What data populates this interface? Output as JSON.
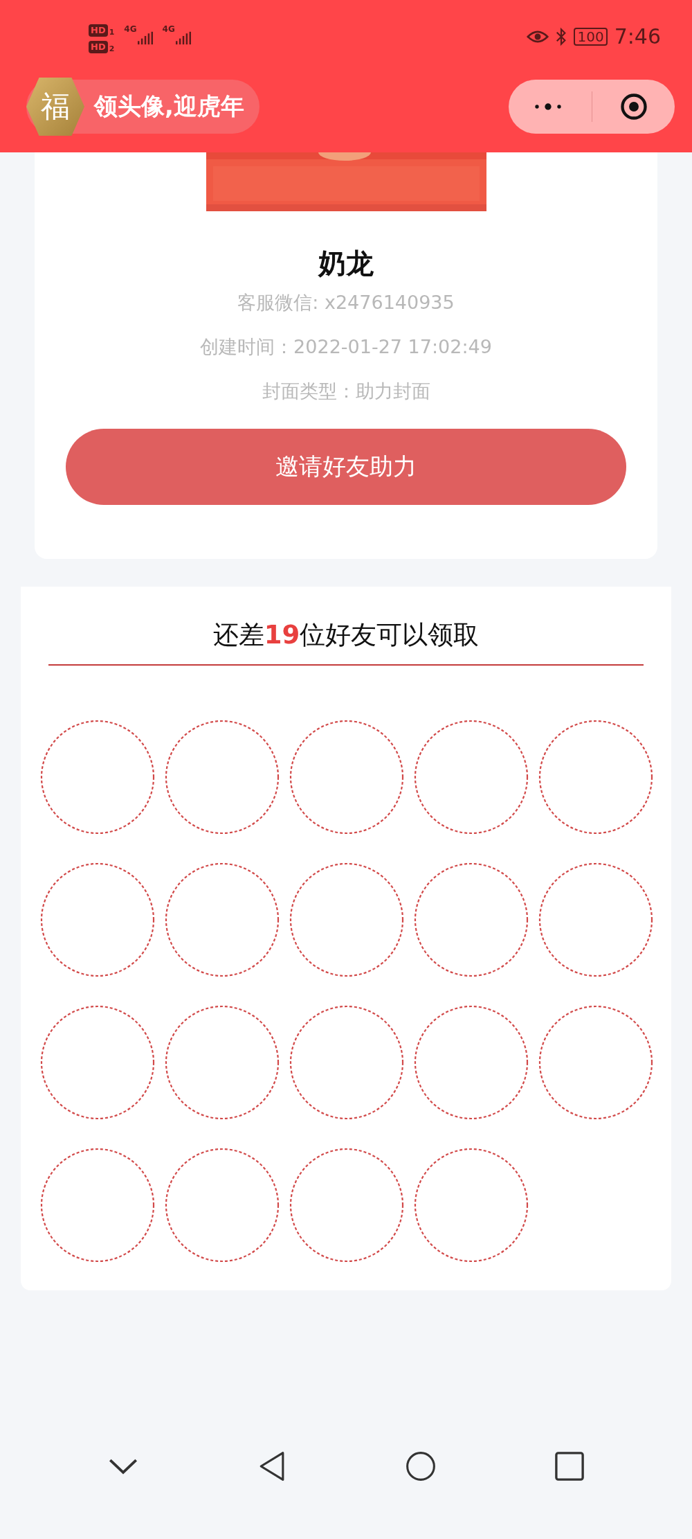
{
  "status_bar": {
    "sims": [
      {
        "label": "HD",
        "slot": "1"
      },
      {
        "label": "HD",
        "slot": "2"
      }
    ],
    "networks": [
      "4G",
      "4G"
    ],
    "battery": "100",
    "time": "7:46"
  },
  "nav": {
    "badge": "福",
    "title": "领头像,迎虎年"
  },
  "cover": {
    "name": "奶龙",
    "info": [
      "客服微信: x2476140935",
      "创建时间：2022-01-27 17:02:49",
      "封面类型：助力封面"
    ],
    "button": "邀请好友助力"
  },
  "progress": {
    "title": "还差**19**位好友可以领取",
    "slots": [
      {
        "kind": "empty"
      },
      {
        "kind": "empty"
      },
      {
        "kind": "empty"
      },
      {
        "kind": "empty"
      },
      {
        "kind": "empty"
      },
      {
        "kind": "empty"
      },
      {
        "kind": "empty"
      },
      {
        "kind": "empty"
      },
      {
        "kind": "empty"
      },
      {
        "kind": "empty"
      },
      {
        "kind": "empty"
      },
      {
        "kind": "empty"
      },
      {
        "kind": "empty"
      },
      {
        "kind": "empty"
      },
      {
        "kind": "empty"
      },
      {
        "kind": "empty"
      },
      {
        "kind": "empty"
      },
      {
        "kind": "empty"
      },
      {
        "kind": "empty"
      }
    ]
  }
}
